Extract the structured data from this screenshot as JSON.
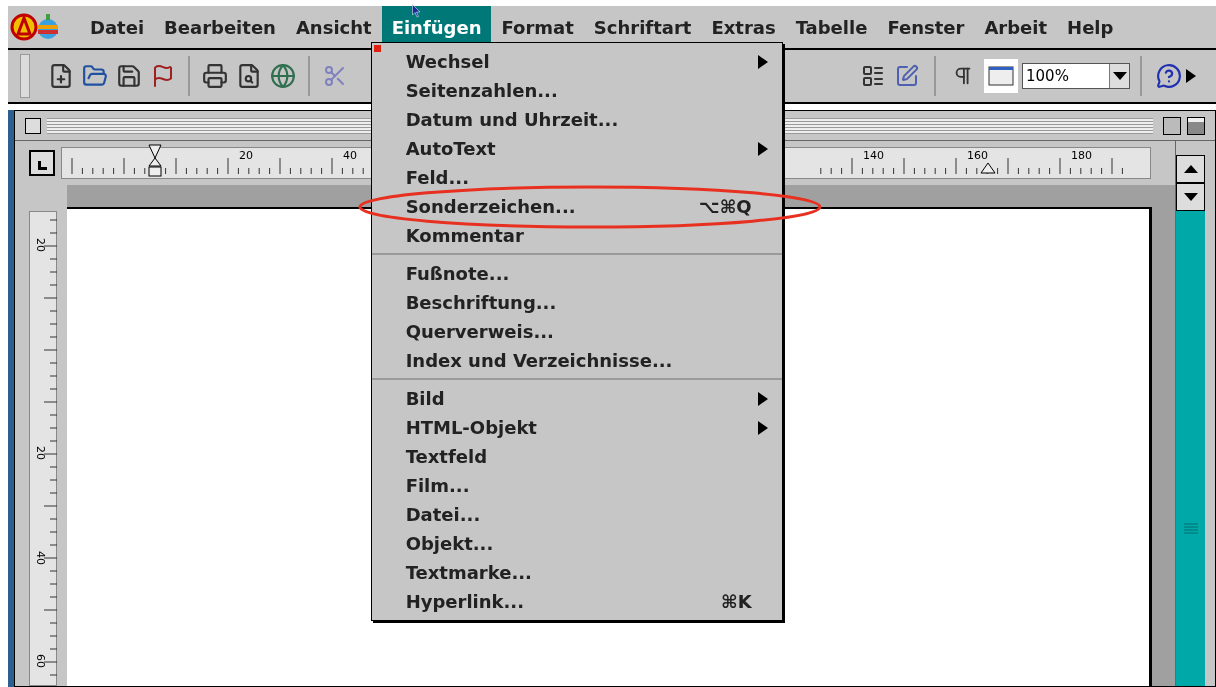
{
  "menu_bar": {
    "items": [
      {
        "label": "Datei",
        "selected": false
      },
      {
        "label": "Bearbeiten",
        "selected": false
      },
      {
        "label": "Ansicht",
        "selected": false
      },
      {
        "label": "Einfügen",
        "selected": true
      },
      {
        "label": "Format",
        "selected": false
      },
      {
        "label": "Schriftart",
        "selected": false
      },
      {
        "label": "Extras",
        "selected": false
      },
      {
        "label": "Tabelle",
        "selected": false
      },
      {
        "label": "Fenster",
        "selected": false
      },
      {
        "label": "Arbeit",
        "selected": false
      },
      {
        "label": "Help",
        "selected": false
      }
    ]
  },
  "toolbar": {
    "zoom": {
      "value": "100%"
    }
  },
  "ruler": {
    "labels": [
      "20",
      "40",
      "140",
      "160",
      "180"
    ]
  },
  "vertical_ruler": {
    "labels": [
      "20",
      "20",
      "40",
      "60"
    ]
  },
  "dropdown": {
    "sections": [
      [
        {
          "label": "Wechsel",
          "submenu": true
        },
        {
          "label": "Seitenzahlen...",
          "submenu": false
        },
        {
          "label": "Datum und Uhrzeit...",
          "submenu": false
        },
        {
          "label": "AutoText",
          "submenu": true
        },
        {
          "label": "Feld...",
          "submenu": false
        },
        {
          "label": "Sonderzeichen...",
          "submenu": false,
          "shortcut": "⌥⌘Q"
        },
        {
          "label": "Kommentar",
          "submenu": false
        }
      ],
      [
        {
          "label": "Fußnote...",
          "submenu": false
        },
        {
          "label": "Beschriftung...",
          "submenu": false
        },
        {
          "label": "Querverweis...",
          "submenu": false
        },
        {
          "label": "Index und Verzeichnisse...",
          "submenu": false
        }
      ],
      [
        {
          "label": "Bild",
          "submenu": true
        },
        {
          "label": "HTML-Objekt",
          "submenu": true
        },
        {
          "label": "Textfeld",
          "submenu": false
        },
        {
          "label": "Film...",
          "submenu": false
        },
        {
          "label": "Datei...",
          "submenu": false
        },
        {
          "label": "Objekt...",
          "submenu": false
        },
        {
          "label": "Textmarke...",
          "submenu": false
        },
        {
          "label": "Hyperlink...",
          "submenu": false,
          "shortcut": "⌘K"
        }
      ]
    ]
  }
}
